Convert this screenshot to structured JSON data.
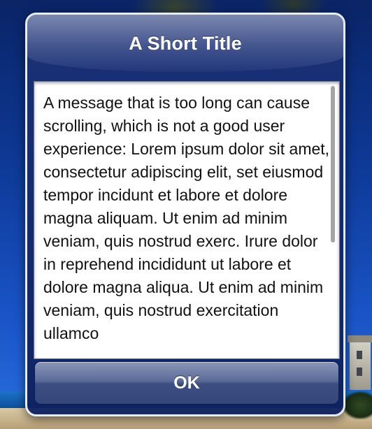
{
  "alert": {
    "title": "A Short Title",
    "message": "A message that is too long can cause scrolling, which is not a good user experience: Lorem ipsum dolor sit amet, consectetur adipiscing elit, set eiusmod tempor incidunt et labore et dolore magna aliquam. Ut enim ad minim veniam, quis nostrud exerc. Irure dolor in reprehend incididunt ut labore et dolore magna aliqua. Ut enim ad minim veniam, quis nostrud exercitation ullamco",
    "ok_label": "OK"
  },
  "colors": {
    "alert_background": "#1c3278",
    "alert_border": "#e6ecf7",
    "message_background": "#ffffff",
    "title_text": "#ffffff"
  }
}
